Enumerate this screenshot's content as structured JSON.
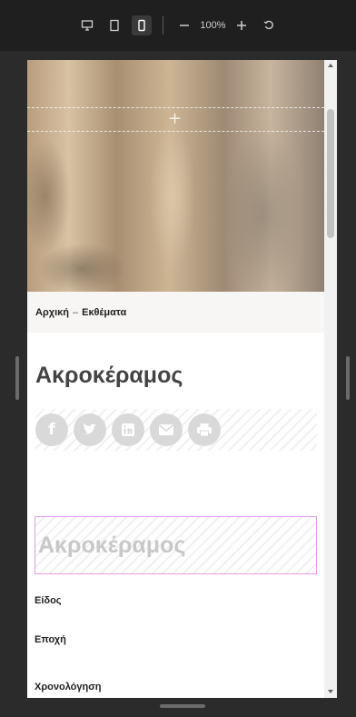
{
  "toolbar": {
    "zoom": "100%",
    "icons": [
      "desktop-icon",
      "tablet-icon",
      "mobile-icon",
      "zoom-out-icon",
      "zoom-in-icon",
      "reset-icon"
    ]
  },
  "breadcrumb": {
    "home": "Αρχική",
    "separator": "–",
    "current": "Εκθέματα"
  },
  "page": {
    "title": "Ακροκέραμος",
    "heading_placeholder": "Ακροκέραμος"
  },
  "share": {
    "icons": [
      "facebook-icon",
      "twitter-icon",
      "linkedin-icon",
      "email-icon",
      "print-icon"
    ]
  },
  "fields": {
    "type_label": "Είδος",
    "era_label": "Εποχή",
    "dating_label": "Χρονολόγηση"
  },
  "colors": {
    "toolbar_bg": "#1f1f1f",
    "outer_bg": "#2b2b2b",
    "breadcrumb_bg": "#f8f6f4",
    "placeholder_border": "#e59be8",
    "share_icon": "#d9d9d9"
  }
}
